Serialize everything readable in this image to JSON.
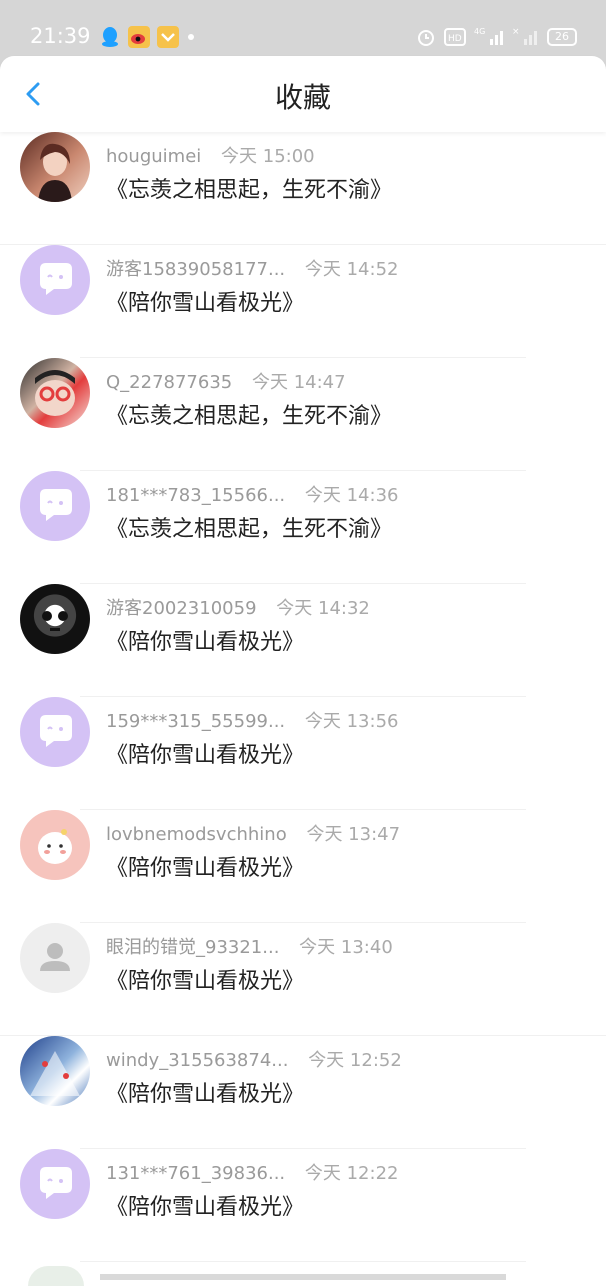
{
  "status_bar": {
    "time": "21:39",
    "battery": "26",
    "icons": [
      "qq-icon",
      "weibo-icon",
      "wallet-icon",
      "notification-dot",
      "alarm-icon",
      "hd-icon",
      "signal-4g-icon",
      "signal-icon"
    ]
  },
  "header": {
    "title": "收藏",
    "back_icon": "chevron-left-icon",
    "accent": "#2d9cf2"
  },
  "items": [
    {
      "user": "houguimei",
      "time": "今天 15:00",
      "title": "《忘羡之相思起，生死不渝》",
      "avatar": "photo1"
    },
    {
      "user": "游客15839058177...",
      "time": "今天 14:52",
      "title": "《陪你雪山看极光》",
      "avatar": "purple"
    },
    {
      "user": "Q_227877635",
      "time": "今天 14:47",
      "title": "《忘羡之相思起，生死不渝》",
      "avatar": "photo2"
    },
    {
      "user": "181***783_15566...",
      "time": "今天 14:36",
      "title": "《忘羡之相思起，生死不渝》",
      "avatar": "purple"
    },
    {
      "user": "游客2002310059",
      "time": "今天 14:32",
      "title": "《陪你雪山看极光》",
      "avatar": "photo3"
    },
    {
      "user": "159***315_55599...",
      "time": "今天 13:56",
      "title": "《陪你雪山看极光》",
      "avatar": "purple"
    },
    {
      "user": "lovbnemodsvchhino",
      "time": "今天 13:47",
      "title": "《陪你雪山看极光》",
      "avatar": "photo4"
    },
    {
      "user": "眼泪的错觉_93321...",
      "time": "今天 13:40",
      "title": "《陪你雪山看极光》",
      "avatar": "gray"
    },
    {
      "user": "windy_315563874...",
      "time": "今天 12:52",
      "title": "《陪你雪山看极光》",
      "avatar": "photo5"
    },
    {
      "user": "131***761_39836...",
      "time": "今天 12:22",
      "title": "《陪你雪山看极光》",
      "avatar": "purple"
    }
  ]
}
